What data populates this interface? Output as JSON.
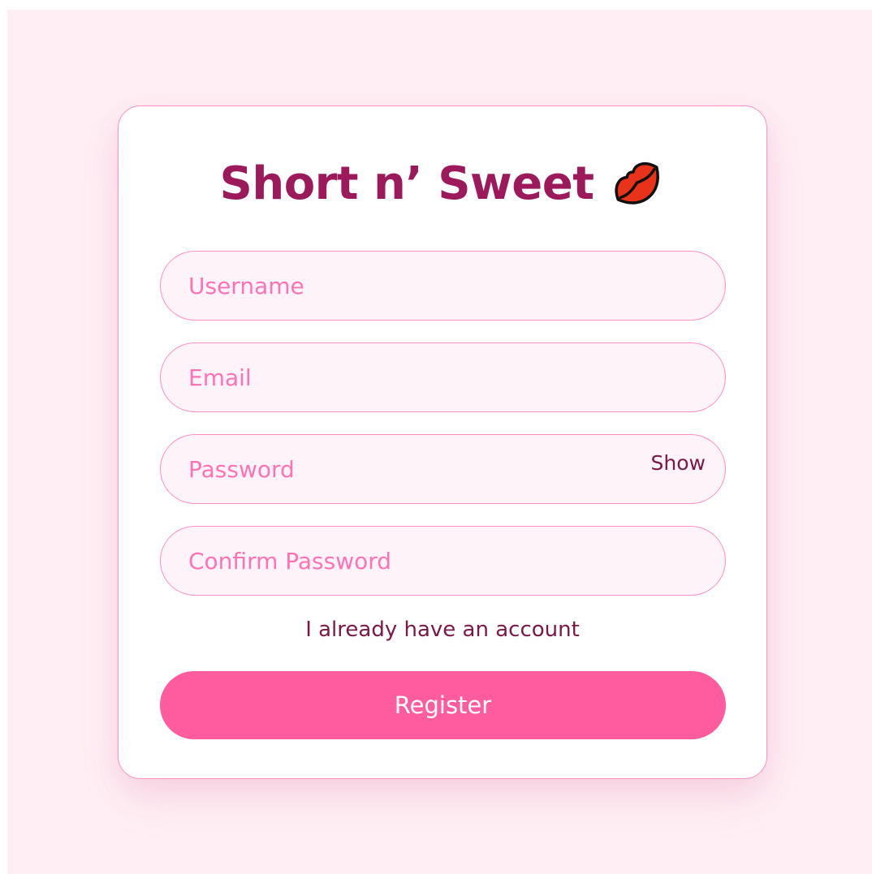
{
  "app": {
    "title": "Short n’ Sweet",
    "title_icon": "lips-icon"
  },
  "form": {
    "username": {
      "value": "",
      "placeholder": "Username"
    },
    "email": {
      "value": "",
      "placeholder": "Email"
    },
    "password": {
      "value": "",
      "placeholder": "Password",
      "toggle_label": "Show"
    },
    "confirm_password": {
      "value": "",
      "placeholder": "Confirm Password"
    },
    "login_link": "I already have an account",
    "submit_label": "Register"
  },
  "colors": {
    "page_background": "#ffeff5",
    "card_border": "#ff8fc7",
    "title": "#9c1a5c",
    "placeholder": "#ff73b6",
    "field_background": "#fff3fa",
    "button": "#ff5ca0",
    "button_text": "#ffffff",
    "link_text": "#7a1848",
    "icon_fill": "#e8321a"
  }
}
